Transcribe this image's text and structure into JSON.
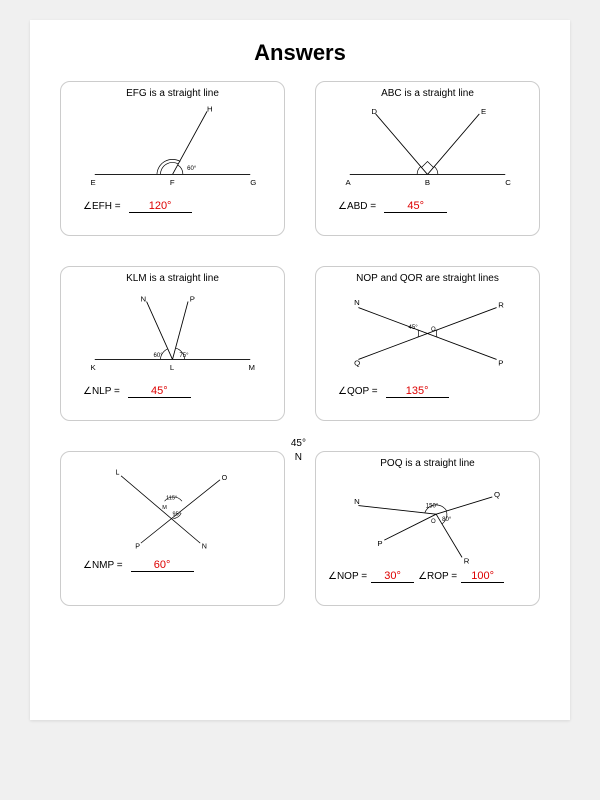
{
  "title": "Answers",
  "cards": [
    {
      "heading": "EFG is a straight line",
      "points": [
        "E",
        "F",
        "G",
        "H"
      ],
      "given_angles": [
        "60°"
      ],
      "question": "∠EFH =",
      "answer": "120°"
    },
    {
      "heading": "ABC is a straight line",
      "points": [
        "A",
        "B",
        "C",
        "D",
        "E"
      ],
      "given_angles": [],
      "question": "∠ABD =",
      "answer": "45°"
    },
    {
      "heading": "KLM is a straight line",
      "points": [
        "K",
        "L",
        "M",
        "N",
        "P"
      ],
      "given_angles": [
        "60°",
        "75°"
      ],
      "question": "∠NLP =",
      "answer": "45°"
    },
    {
      "heading": "NOP and QOR are straight lines",
      "points": [
        "N",
        "O",
        "P",
        "Q",
        "R"
      ],
      "given_angles": [
        "45°"
      ],
      "question": "∠QOP =",
      "answer": "135°"
    },
    {
      "heading": "",
      "points": [
        "L",
        "M",
        "N",
        "O",
        "P"
      ],
      "given_angles": [
        "115°",
        "95°"
      ],
      "question": "∠NMP =",
      "answer": "60°",
      "ext_labels": [
        "45°",
        "N"
      ]
    },
    {
      "heading": "POQ is a straight line",
      "points": [
        "N",
        "O",
        "P",
        "Q",
        "R"
      ],
      "given_angles": [
        "150°",
        "80°"
      ],
      "questions": [
        {
          "label": "∠NOP =",
          "answer": "30°"
        },
        {
          "label": "∠ROP =",
          "answer": "100°"
        }
      ]
    }
  ]
}
